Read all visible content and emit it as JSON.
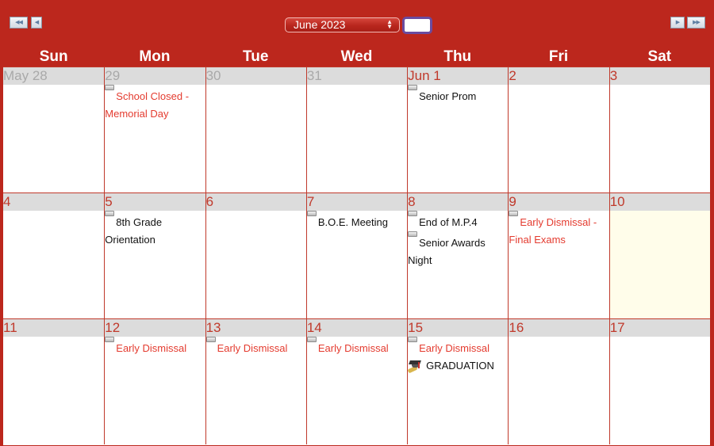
{
  "toolbar": {
    "prev_year_icon": "◀◀",
    "prev_month_icon": "◀",
    "next_month_icon": "▶",
    "next_year_icon": "▶▶",
    "month_select_value": "June 2023",
    "go_box_value": ""
  },
  "colors": {
    "brand_red": "#bc271d",
    "event_red": "#e43b2f",
    "header_gray": "#dcdcdc",
    "today_bg": "#fffdea"
  },
  "days_of_week": [
    "Sun",
    "Mon",
    "Tue",
    "Wed",
    "Thu",
    "Fri",
    "Sat"
  ],
  "weeks": [
    {
      "days": [
        {
          "label": "May 28",
          "other_month": true,
          "events": []
        },
        {
          "label": "29",
          "other_month": true,
          "events": [
            {
              "text": "School Closed - Memorial Day",
              "color": "red",
              "icon": "checkbox"
            }
          ]
        },
        {
          "label": "30",
          "other_month": true,
          "events": []
        },
        {
          "label": "31",
          "other_month": true,
          "events": []
        },
        {
          "label": "Jun 1",
          "other_month": false,
          "events": [
            {
              "text": "Senior Prom",
              "color": "black",
              "icon": "checkbox"
            }
          ]
        },
        {
          "label": "2",
          "other_month": false,
          "events": []
        },
        {
          "label": "3",
          "other_month": false,
          "events": []
        }
      ]
    },
    {
      "days": [
        {
          "label": "4",
          "other_month": false,
          "events": []
        },
        {
          "label": "5",
          "other_month": false,
          "events": [
            {
              "text": "8th Grade Orientation",
              "color": "black",
              "icon": "checkbox"
            }
          ]
        },
        {
          "label": "6",
          "other_month": false,
          "events": []
        },
        {
          "label": "7",
          "other_month": false,
          "events": [
            {
              "text": "B.O.E. Meeting",
              "color": "black",
              "icon": "checkbox"
            }
          ]
        },
        {
          "label": "8",
          "other_month": false,
          "events": [
            {
              "text": "End of M.P.4",
              "color": "black",
              "icon": "checkbox"
            },
            {
              "text": "Senior Awards Night",
              "color": "black",
              "icon": "checkbox"
            }
          ]
        },
        {
          "label": "9",
          "other_month": false,
          "events": [
            {
              "text": "Early Dismissal - Final Exams",
              "color": "red",
              "icon": "checkbox"
            }
          ]
        },
        {
          "label": "10",
          "other_month": false,
          "today": true,
          "events": []
        }
      ]
    },
    {
      "days": [
        {
          "label": "11",
          "other_month": false,
          "events": []
        },
        {
          "label": "12",
          "other_month": false,
          "events": [
            {
              "text": "Early Dismissal",
              "color": "red",
              "icon": "checkbox"
            }
          ]
        },
        {
          "label": "13",
          "other_month": false,
          "events": [
            {
              "text": "Early Dismissal",
              "color": "red",
              "icon": "checkbox"
            }
          ]
        },
        {
          "label": "14",
          "other_month": false,
          "events": [
            {
              "text": "Early Dismissal",
              "color": "red",
              "icon": "checkbox"
            }
          ]
        },
        {
          "label": "15",
          "other_month": false,
          "events": [
            {
              "text": "Early Dismissal",
              "color": "red",
              "icon": "checkbox"
            },
            {
              "text": "GRADUATION",
              "color": "black",
              "icon": "graduation-cap"
            }
          ]
        },
        {
          "label": "16",
          "other_month": false,
          "events": []
        },
        {
          "label": "17",
          "other_month": false,
          "events": []
        }
      ]
    }
  ]
}
